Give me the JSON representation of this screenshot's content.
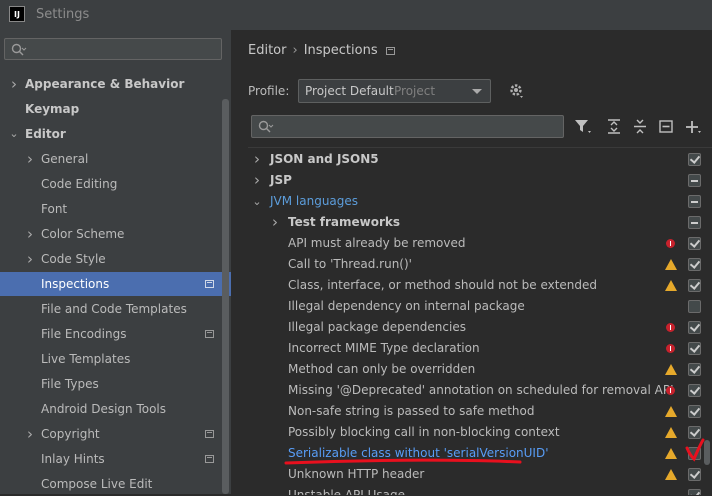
{
  "window": {
    "logo": "IJ",
    "title": "Settings"
  },
  "sidebar": {
    "search_placeholder": "",
    "items": [
      {
        "label": "Appearance & Behavior",
        "level": 0,
        "chevron": "right",
        "bold": true
      },
      {
        "label": "Keymap",
        "level": 0,
        "chevron": "",
        "bold": true
      },
      {
        "label": "Editor",
        "level": 0,
        "chevron": "down",
        "bold": true
      },
      {
        "label": "General",
        "level": 1,
        "chevron": "right"
      },
      {
        "label": "Code Editing",
        "level": 1,
        "chevron": ""
      },
      {
        "label": "Font",
        "level": 1,
        "chevron": ""
      },
      {
        "label": "Color Scheme",
        "level": 1,
        "chevron": "right"
      },
      {
        "label": "Code Style",
        "level": 1,
        "chevron": "right"
      },
      {
        "label": "Inspections",
        "level": 1,
        "chevron": "",
        "selected": true,
        "project_icon": true
      },
      {
        "label": "File and Code Templates",
        "level": 1,
        "chevron": ""
      },
      {
        "label": "File Encodings",
        "level": 1,
        "chevron": "",
        "project_icon": true
      },
      {
        "label": "Live Templates",
        "level": 1,
        "chevron": ""
      },
      {
        "label": "File Types",
        "level": 1,
        "chevron": ""
      },
      {
        "label": "Android Design Tools",
        "level": 1,
        "chevron": ""
      },
      {
        "label": "Copyright",
        "level": 1,
        "chevron": "right",
        "project_icon": true
      },
      {
        "label": "Inlay Hints",
        "level": 1,
        "chevron": "",
        "project_icon": true
      },
      {
        "label": "Compose Live Edit",
        "level": 1,
        "chevron": ""
      }
    ]
  },
  "breadcrumb": {
    "parent": "Editor",
    "separator": "›",
    "current": "Inspections"
  },
  "profile": {
    "label": "Profile:",
    "value": "Project Default",
    "scope": "Project"
  },
  "toolbar_icons": [
    "filter-icon",
    "expand-all-icon",
    "collapse-all-icon",
    "remove-icon",
    "add-icon"
  ],
  "inspections": [
    {
      "label": "JSON and JSON5",
      "level": 0,
      "chevron": "right",
      "kind": "group",
      "severity": "",
      "check": "checked"
    },
    {
      "label": "JSP",
      "level": 0,
      "chevron": "right",
      "kind": "group",
      "severity": "",
      "check": "partial"
    },
    {
      "label": "JVM languages",
      "level": 0,
      "chevron": "down",
      "kind": "accent",
      "severity": "",
      "check": "partial"
    },
    {
      "label": "Test frameworks",
      "level": 1,
      "chevron": "right",
      "kind": "group",
      "severity": "",
      "check": "partial"
    },
    {
      "label": "API must already be removed",
      "level": 2,
      "severity": "error",
      "check": "checked"
    },
    {
      "label": "Call to 'Thread.run()'",
      "level": 2,
      "severity": "warning",
      "check": "checked"
    },
    {
      "label": "Class, interface, or method should not be extended",
      "level": 2,
      "severity": "warning",
      "check": "checked"
    },
    {
      "label": "Illegal dependency on internal package",
      "level": 2,
      "severity": "",
      "check": "unchecked"
    },
    {
      "label": "Illegal package dependencies",
      "level": 2,
      "severity": "error",
      "check": "checked"
    },
    {
      "label": "Incorrect MIME Type declaration",
      "level": 2,
      "severity": "error",
      "check": "checked"
    },
    {
      "label": "Method can only be overridden",
      "level": 2,
      "severity": "warning",
      "check": "checked"
    },
    {
      "label": "Missing '@Deprecated' annotation on scheduled for removal API",
      "level": 2,
      "severity": "error",
      "check": "checked"
    },
    {
      "label": "Non-safe string is passed to safe method",
      "level": 2,
      "severity": "warning",
      "check": "checked"
    },
    {
      "label": "Possibly blocking call in non-blocking context",
      "level": 2,
      "severity": "warning",
      "check": "checked"
    },
    {
      "label": "Serializable class without 'serialVersionUID'",
      "level": 2,
      "severity": "warning",
      "check": "unchecked",
      "kind": "link",
      "annotated": true
    },
    {
      "label": "Unknown HTTP header",
      "level": 2,
      "severity": "warning",
      "check": "checked"
    },
    {
      "label": "Unstable API Usage",
      "level": 2,
      "severity": "",
      "check": "checked"
    }
  ],
  "colors": {
    "annotation": "#e8101e",
    "selection": "#4b6eaf",
    "link": "#589df6"
  }
}
